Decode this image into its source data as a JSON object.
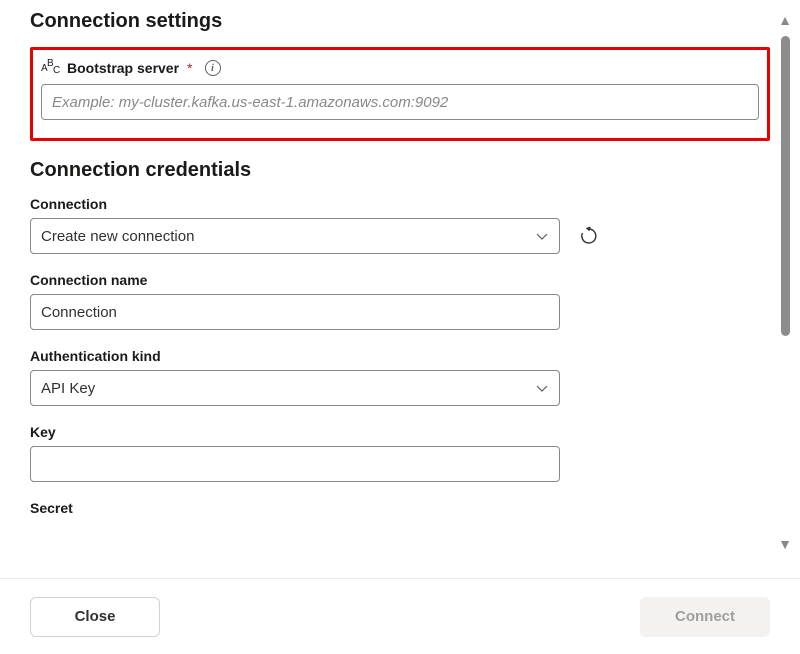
{
  "sections": {
    "connection_settings": {
      "title": "Connection settings",
      "bootstrap_server": {
        "label": "Bootstrap server",
        "placeholder": "Example: my-cluster.kafka.us-east-1.amazonaws.com:9092",
        "value": ""
      }
    },
    "connection_credentials": {
      "title": "Connection credentials",
      "connection": {
        "label": "Connection",
        "selected": "Create new connection"
      },
      "connection_name": {
        "label": "Connection name",
        "value": "Connection"
      },
      "authentication_kind": {
        "label": "Authentication kind",
        "selected": "API Key"
      },
      "key": {
        "label": "Key",
        "value": ""
      },
      "secret": {
        "label": "Secret",
        "value": ""
      }
    }
  },
  "footer": {
    "close_label": "Close",
    "connect_label": "Connect"
  }
}
